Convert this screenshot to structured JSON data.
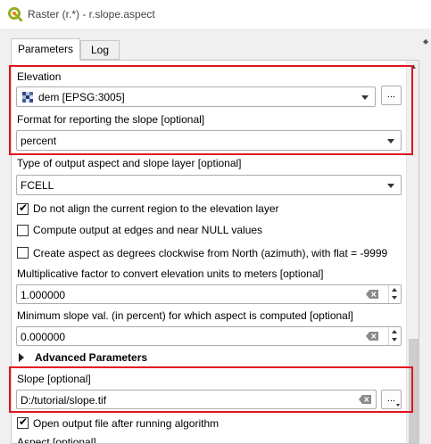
{
  "window": {
    "title": "Raster (r.*) - r.slope.aspect",
    "app_icon": "qgis-logo-icon",
    "accent_color": "#e0141e"
  },
  "tabs": [
    {
      "label": "Parameters",
      "active": true
    },
    {
      "label": "Log",
      "active": false
    }
  ],
  "params": {
    "elevation": {
      "label": "Elevation",
      "value": "dem [EPSG:3005]",
      "icon": "raster-layer-icon",
      "button_label": "..."
    },
    "format": {
      "label": "Format for reporting the slope [optional]",
      "value": "percent"
    },
    "type": {
      "label": "Type of output aspect and slope layer [optional]",
      "value": "FCELL"
    },
    "checkboxes": [
      {
        "label": "Do not align the current region to the elevation layer",
        "checked": true
      },
      {
        "label": "Compute output at edges and near NULL values",
        "checked": false
      },
      {
        "label": "Create aspect as degrees clockwise from North (azimuth), with flat = -9999",
        "checked": false
      }
    ],
    "multiplicative": {
      "label": "Multiplicative factor to convert elevation units to meters [optional]",
      "value": "1.000000"
    },
    "min_slope": {
      "label": "Minimum slope val. (in percent) for which aspect is computed [optional]",
      "value": "0.000000"
    },
    "advanced_label": "Advanced Parameters",
    "slope": {
      "label": "Slope [optional]",
      "value": "D:/tutorial/slope.tif",
      "button_label": "..."
    },
    "open_output": {
      "label": "Open output file after running algorithm",
      "checked": true
    },
    "aspect_label": "Aspect [optional]"
  }
}
